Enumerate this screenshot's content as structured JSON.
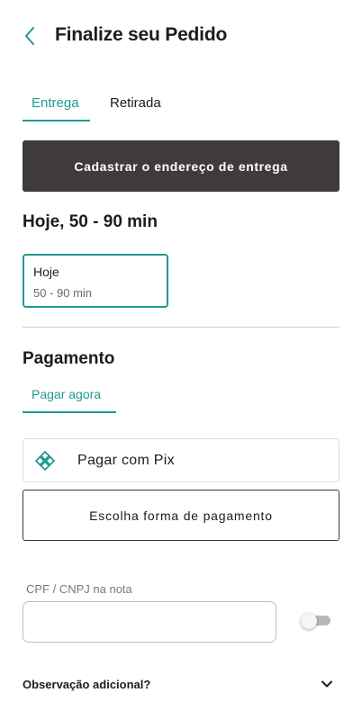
{
  "header": {
    "title": "Finalize seu Pedido",
    "back_icon": "chevron-left-icon"
  },
  "delivery_tabs": [
    {
      "label": "Entrega",
      "active": true
    },
    {
      "label": "Retirada",
      "active": false
    }
  ],
  "address_button": {
    "label": "Cadastrar o endereço de entrega"
  },
  "schedule": {
    "heading": "Hoje, 50 - 90 min",
    "option": {
      "day": "Hoje",
      "range": "50 - 90 min",
      "selected": true
    }
  },
  "payment": {
    "heading": "Pagamento",
    "tab": "Pagar agora",
    "pix_button": "Pagar com Pix",
    "pix_icon": "pix-icon",
    "choose_button": "Escolha forma de pagamento"
  },
  "cpf": {
    "label": "CPF / CNPJ na nota",
    "value": "",
    "toggle_on": false
  },
  "observation": {
    "label": "Observação adicional?",
    "icon": "chevron-down-icon"
  },
  "colors": {
    "accent": "#1f9a91",
    "dark_button": "#3f3b3b"
  }
}
